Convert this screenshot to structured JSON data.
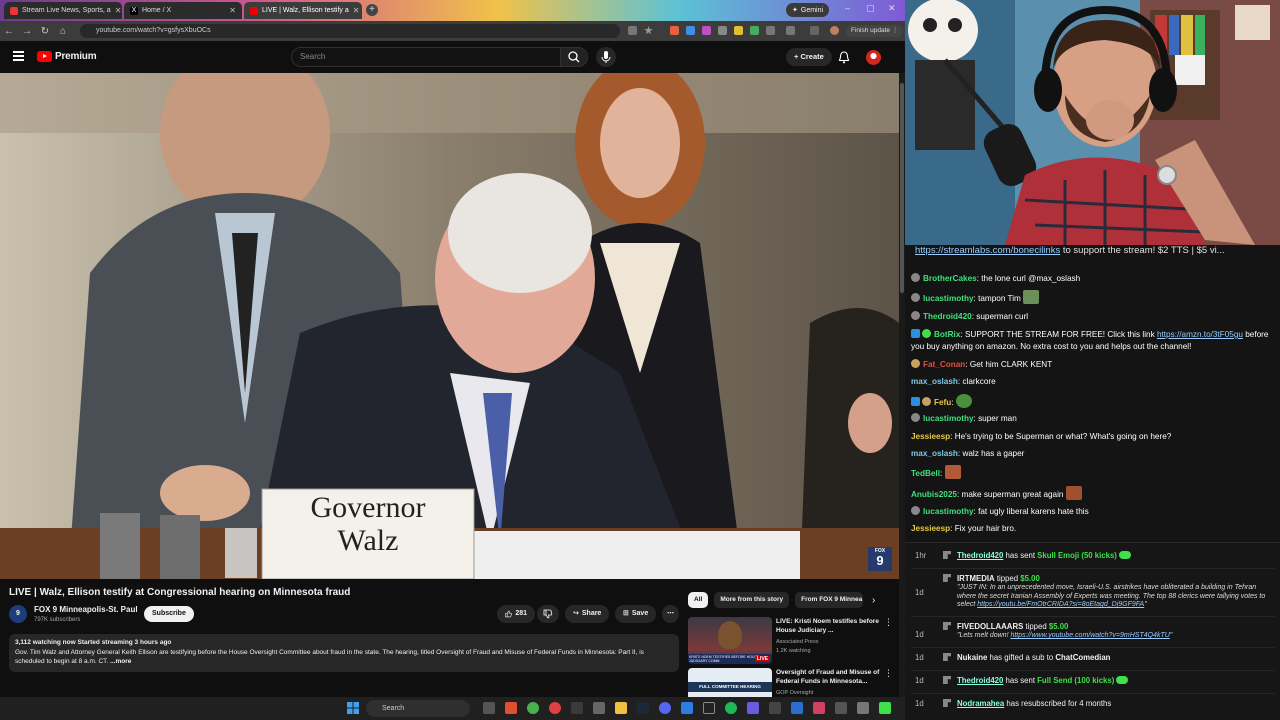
{
  "browser": {
    "tabs": [
      {
        "label": "Stream Live News, Sports, a",
        "fav_color": "#e33"
      },
      {
        "label": "Home / X",
        "fav_color": "#111"
      },
      {
        "label": "LIVE | Walz, Ellison testify a",
        "fav_color": "#e00"
      }
    ],
    "gemini_label": "Gemini",
    "url": "youtube.com/watch?v=gsfysXbuOCs",
    "finish_update": "Finish update"
  },
  "youtube": {
    "logo_text": "Premium",
    "search_placeholder": "Search",
    "create_label": "Create",
    "video_title": "LIVE | Walz, Ellison testify at Congressional hearing on Minnesota fraud",
    "nameplate_line1": "Governor",
    "nameplate_line2": "Walz",
    "fox_bug_top": "FOX",
    "fox_bug_num": "9",
    "channel": {
      "name": "FOX 9 Minneapolis-St. Paul",
      "subs": "797K subscribers",
      "avatar_text": "9"
    },
    "subscribe_label": "Subscribe",
    "likes": "281",
    "share_label": "Share",
    "save_label": "Save",
    "description": {
      "meta": "3,112 watching now  Started streaming 3 hours ago",
      "text": "Gov. Tim Walz and Attorney General Keith Ellison are testifying before the House Oversight Committee about fraud in the state. The hearing, titled Oversight of Fraud and Misuse of Federal Funds in Minnesota: Part II, is scheduled to begin at 8 a.m. CT.",
      "more": "...more"
    },
    "chips": [
      "All",
      "More from this story",
      "From FOX 9 Minnea"
    ],
    "recommendations": [
      {
        "title": "LIVE: Kristi Noem testifies before House Judiciary ...",
        "channel": "Associated Press",
        "stat": "1.2K watching",
        "thumb_caption": "KRISTI NOEM TESTIFIES BEFORE HOUSE JUDICIARY COMM",
        "badge": "LIVE"
      },
      {
        "title": "Oversight of Fraud and Misuse of Federal Funds in Minnesota...",
        "channel": "GOP Oversight",
        "stat": "",
        "thumb_caption": "FULL COMMITTEE HEARING",
        "badge": ""
      }
    ]
  },
  "taskbar": {
    "search_label": "Search"
  },
  "chat": {
    "pinned": {
      "link": "https://streamlabs.com/bonecilinks",
      "text": " to support the stream! $2 TTS | $5 vi..."
    },
    "messages": [
      {
        "user": "BrotherCakes",
        "color": "#3fe07a",
        "text": "the lone curl @max_oslash",
        "badge": "#888",
        "emote": ""
      },
      {
        "user": "lucastimothy",
        "color": "#3fe07a",
        "text": "tampon Tim",
        "badge": "#888",
        "emote": "#6a8f5a"
      },
      {
        "user": "Thedroid420",
        "color": "#3fe07a",
        "text": "superman curl",
        "badge": "#888",
        "emote": ""
      },
      {
        "user": "BotRix",
        "color": "#3fe07a",
        "text": "SUPPORT THE STREAM FOR FREE! Click this link ",
        "link": "https://amzn.to/3tF05gu",
        "text2": " before you buy anything on amazon. No extra cost to you and helps out the channel!",
        "badge": "#2a8fe0",
        "emote": ""
      },
      {
        "user": "Fat_Conan",
        "color": "#e0503f",
        "text": "Get him CLARK KENT",
        "badge": "#c8a060",
        "emote": ""
      },
      {
        "user": "max_oslash",
        "color": "#7fc8e8",
        "text": "clarkcore",
        "badge": "",
        "emote": ""
      },
      {
        "user": "Fefu",
        "color": "#e8c83f",
        "text": "",
        "badge": "#2a8fe0",
        "emote": "#4a8f3a"
      },
      {
        "user": "lucastimothy",
        "color": "#3fe07a",
        "text": "super man",
        "badge": "#888",
        "emote": ""
      },
      {
        "user": "Jessieesp",
        "color": "#e8c83f",
        "text": "He's trying to be Superman or what? What's going on here?",
        "badge": "",
        "emote": ""
      },
      {
        "user": "max_oslash",
        "color": "#7fc8e8",
        "text": "walz has a gaper",
        "badge": "",
        "emote": ""
      },
      {
        "user": "TedBell",
        "color": "#3fe07a",
        "text": "",
        "badge": "",
        "emote": "#b05a3a"
      },
      {
        "user": "Anubis2025",
        "color": "#3fe07a",
        "text": "make superman great again",
        "badge": "",
        "emote": "#a05030"
      },
      {
        "user": "lucastimothy",
        "color": "#3fe07a",
        "text": "fat ugly liberal karens hate this",
        "badge": "#888",
        "emote": ""
      },
      {
        "user": "Jessieesp",
        "color": "#e8c83f",
        "text": "Fix your hair bro.",
        "badge": "",
        "emote": ""
      }
    ]
  },
  "events": [
    {
      "age": "1hr",
      "name": "Thedroid420",
      "action": " has sent ",
      "gift": "Skull Emoji (50 kicks)",
      "quote": "",
      "link": ""
    },
    {
      "age": "1d",
      "name": "IRTMEDIA",
      "action": " tipped ",
      "gift": "$5.00",
      "quote": "\"JUST IN: In an unprecedented move, Israeli-U.S. airstrikes have obliterated a building in Tehran where the secret Iranian Assembly of Experts was meeting. The top 88 clerics were tallying votes to select ",
      "link": "https://youtu.be/FmOtrCRIDA?si=8oEtagd_Dj9GF9FA",
      "quote_end": "\""
    },
    {
      "age": "1d",
      "name": "FIVEDOLLAAARS",
      "action": " tipped ",
      "gift": "$5.00",
      "quote": "\"Lets melt down! ",
      "link": "https://www.youtube.com/watch?v=9mHST4Q4kTU",
      "quote_end": "\""
    },
    {
      "age": "1d",
      "name": "Nukaine",
      "action": " has gifted a sub to ",
      "gift": "",
      "target": "ChatComedian",
      "quote": "",
      "link": ""
    },
    {
      "age": "1d",
      "name": "Thedroid420",
      "action": " has sent ",
      "gift": "Full Send (100 kicks)",
      "quote": "",
      "link": ""
    },
    {
      "age": "1d",
      "name": "Nodramahea",
      "action": " has resubscribed for 4 months",
      "gift": "",
      "quote": "",
      "link": ""
    }
  ]
}
